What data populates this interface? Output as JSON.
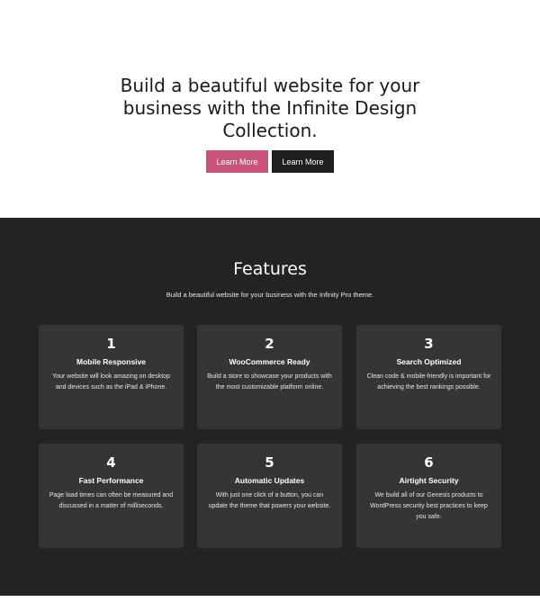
{
  "hero": {
    "title": "Build a beautiful website for your business with the Infinite Design Collection.",
    "primary_button": "Learn More",
    "secondary_button": "Learn More"
  },
  "features": {
    "title": "Features",
    "subtitle": "Build a beautiful website for your business with the Infinity Pro theme.",
    "cards": [
      {
        "number": "1",
        "title": "Mobile Responsive",
        "text": "Your website will look amazing on desktop and devices such as the iPad & iPhone."
      },
      {
        "number": "2",
        "title": "WooCommerce Ready",
        "text": "Build a store to showcase your products with the most customizable platform online."
      },
      {
        "number": "3",
        "title": "Search Optimized",
        "text": "Clean code & mobile-friendly is important for achieving the best rankings possible."
      },
      {
        "number": "4",
        "title": "Fast Performance",
        "text": "Page load times can often be measured and discussed in a matter of milliseconds."
      },
      {
        "number": "5",
        "title": "Automatic Updates",
        "text": "With just one click of a button, you can update the theme that powers your website."
      },
      {
        "number": "6",
        "title": "Airtight Security",
        "text": "We build all of our Genesis products to WordPress security best practices to keep you safe."
      }
    ]
  },
  "colors": {
    "accent": "#c8547a",
    "dark_button": "#1e1e1e",
    "features_bg": "#232323",
    "card_bg": "#353535"
  }
}
